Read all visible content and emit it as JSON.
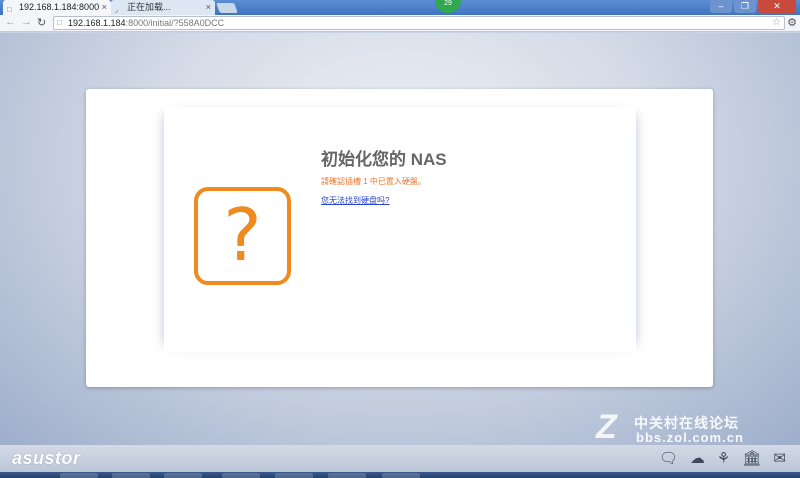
{
  "browser": {
    "tabs": [
      {
        "label": "192.168.1.184:8000",
        "active": true
      },
      {
        "label": "正在加载...",
        "active": false
      }
    ],
    "badge": "29",
    "url_host": "192.168.1.184",
    "url_rest": ":8000/initial/?558A0DCC"
  },
  "dialog": {
    "title": "初始化您的 NAS",
    "message": "請確認插槽 1 中已置入硬盤。",
    "help_link": "您无法找到硬盘吗?",
    "icon": "question-mark-icon",
    "icon_glyph": "?",
    "accent": "#ef8a1e"
  },
  "footer": {
    "logo": "asustor",
    "icons": [
      "chat-icon",
      "cloud-upload-icon",
      "network-icon",
      "bank-icon",
      "mail-icon"
    ]
  },
  "watermark": {
    "mark": "Z",
    "line1": "中关村在线论坛",
    "line2": "bbs.zol.com.cn"
  }
}
